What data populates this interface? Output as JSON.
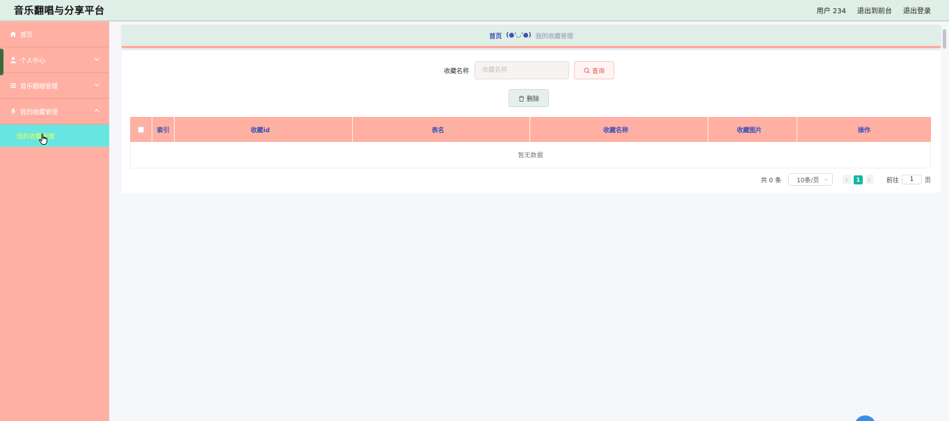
{
  "app": {
    "title": "音乐翻唱与分享平台"
  },
  "top_nav": {
    "user_label": "用户 234",
    "front_link": "退出到前台",
    "logout_link": "退出登录"
  },
  "sidebar": {
    "items": [
      {
        "label": "首页",
        "icon": "home-icon"
      },
      {
        "label": "个人中心",
        "icon": "user-icon"
      },
      {
        "label": "音乐翻唱管理",
        "icon": "menu-icon"
      },
      {
        "label": "我的收藏管理",
        "icon": "mic-icon"
      }
    ],
    "active_sub": {
      "label": "我的收藏管理"
    }
  },
  "breadcrumb": {
    "home": "首页",
    "separator": "(●'◡'●)",
    "current": "我的收藏管理"
  },
  "search": {
    "label": "收藏名称",
    "placeholder": "收藏名称",
    "button": "查询"
  },
  "actions": {
    "delete": "删除"
  },
  "table": {
    "columns": [
      "索引",
      "收藏id",
      "表名",
      "收藏名称",
      "收藏图片",
      "操作"
    ],
    "empty_text": "暂无数据"
  },
  "pagination": {
    "total": "共 0 条",
    "page_size": "10条/页",
    "current_page": "1",
    "goto_prefix": "前往",
    "goto_value": "1",
    "goto_suffix": "页"
  },
  "colors": {
    "topbar_bg": "#dfeee6",
    "sidebar_bg": "#ffb0a3",
    "sidebar_active_bg": "#67e6e1",
    "header_text": "#3f51b5",
    "pager_active": "#13b8a0"
  }
}
